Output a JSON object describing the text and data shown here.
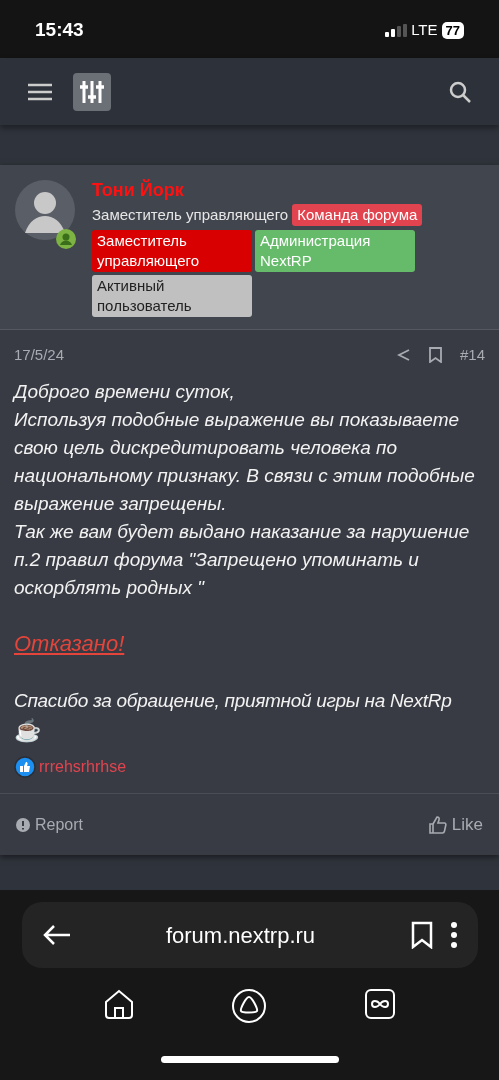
{
  "status_bar": {
    "time": "15:43",
    "network": "LTE",
    "battery": "77"
  },
  "post": {
    "author": {
      "name": "Тони Йорк",
      "title": "Заместитель управляющего",
      "banners": [
        {
          "text": "Команда форума",
          "color": "#e2444f"
        },
        {
          "text": "Заместитель управляющего",
          "color": "#d80000"
        },
        {
          "text": "Администрация NextRP",
          "color": "#66bb6a"
        },
        {
          "text": "Активный пользователь",
          "color": "#c0c0c0"
        }
      ]
    },
    "date": "17/5/24",
    "number": "#14",
    "body": [
      "Доброго времени суток,",
      "Используя подобные выражение вы показываете свою цель дискредитировать человека по национальному признаку. В связи с этим подобные выражение запрещены.",
      "Так же вам будет выдано наказание за нарушение п.2 правил форума \"Запрещено упоминать и оскорблять родных \""
    ],
    "verdict": "Отказано!",
    "closing": "Спасибо за обращение, приятной игры на NextRp",
    "emoji": "☕",
    "reaction_user": "rrrehsrhrhse",
    "actions": {
      "report": "Report",
      "like": "Like"
    }
  },
  "browser": {
    "url": "forum.nextrp.ru"
  }
}
